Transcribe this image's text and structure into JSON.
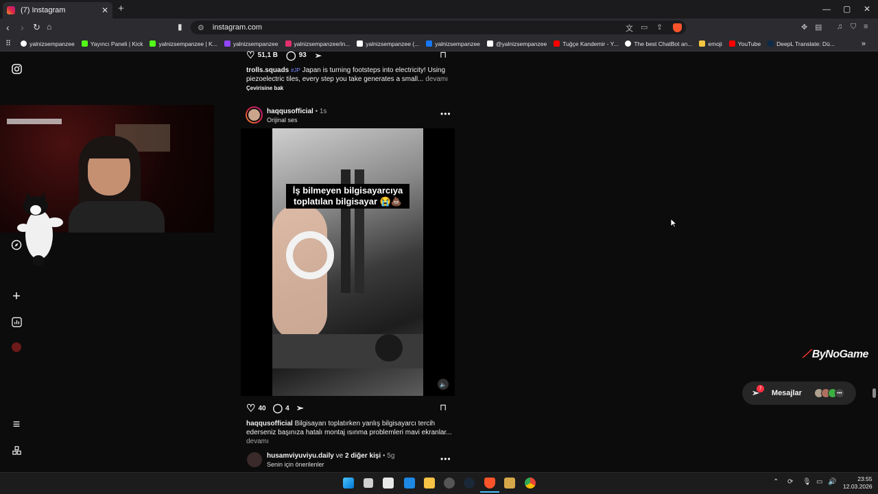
{
  "browser": {
    "tab_title": "(7) Instagram",
    "url": "instagram.com",
    "bookmarks": [
      {
        "label": "yalnizsempanzee",
        "icon": "google-icon",
        "color": "#ffffff"
      },
      {
        "label": "Yayıncı Paneli | Kick",
        "icon": "kick-icon",
        "color": "#53fc18"
      },
      {
        "label": "yalnizsempanzee | K...",
        "icon": "kick-icon",
        "color": "#53fc18"
      },
      {
        "label": "yalnizsempanzee",
        "icon": "twitch-icon",
        "color": "#9146ff"
      },
      {
        "label": "yalnizsempanzee/in...",
        "icon": "instagram-icon",
        "color": "#e1306c"
      },
      {
        "label": "yalnizsempanzee (...",
        "icon": "tiktok-icon",
        "color": "#ffffff"
      },
      {
        "label": "yalnizsempanzee",
        "icon": "facebook-icon",
        "color": "#1877f2"
      },
      {
        "label": "@yalnizsempanzee",
        "icon": "x-icon",
        "color": "#ffffff"
      },
      {
        "label": "Tuğçe Kandemir - Y...",
        "icon": "youtube-icon",
        "color": "#ff0000"
      },
      {
        "label": "The best ChatBot an...",
        "icon": "chatbot-icon",
        "color": "#ffffff"
      },
      {
        "label": "emoji",
        "icon": "emoji-icon",
        "color": "#f5c542"
      },
      {
        "label": "YouTube",
        "icon": "youtube-icon",
        "color": "#ff0000"
      },
      {
        "label": "DeepL Translate: Dü...",
        "icon": "deepl-icon",
        "color": "#0f2b46"
      }
    ]
  },
  "prev_post": {
    "likes": "51,1 B",
    "comments": "93",
    "username": "trolls.squads",
    "hashtag": "#JP",
    "caption": "Japan is turning footsteps into electricity! Using piezoelectric tiles, every step you take generates a small...",
    "more": "devamı",
    "translate": "Çevirisine bak"
  },
  "post": {
    "username": "haqqusofficial",
    "time": "1s",
    "audio": "Orijinal ses",
    "overlay_text": "İş bilmeyen bilgisayarcıya toplatılan bilgisayar 😭💩",
    "likes": "40",
    "comments": "4",
    "caption_user": "haqqusofficial",
    "caption": "Bilgisayarı toplatırken yanlış bilgisayarcı tercih ederseniz başınıza hatalı montaj ısınma problemleri mavi ekranlar...",
    "more": "devamı"
  },
  "next_post": {
    "username": "husamviyuviyu.daily",
    "and_others": "ve",
    "others_count": "2 diğer kişi",
    "time": "5g",
    "subtitle": "Senin için önerilenler"
  },
  "overlay_brand": "ByNoGame",
  "messages": {
    "label": "Mesajlar",
    "badge": "7"
  },
  "clock": {
    "time": "23:55",
    "date": "12.03.2026"
  },
  "colors": {
    "accent": "#ff3040",
    "link": "#a8a8a8"
  }
}
